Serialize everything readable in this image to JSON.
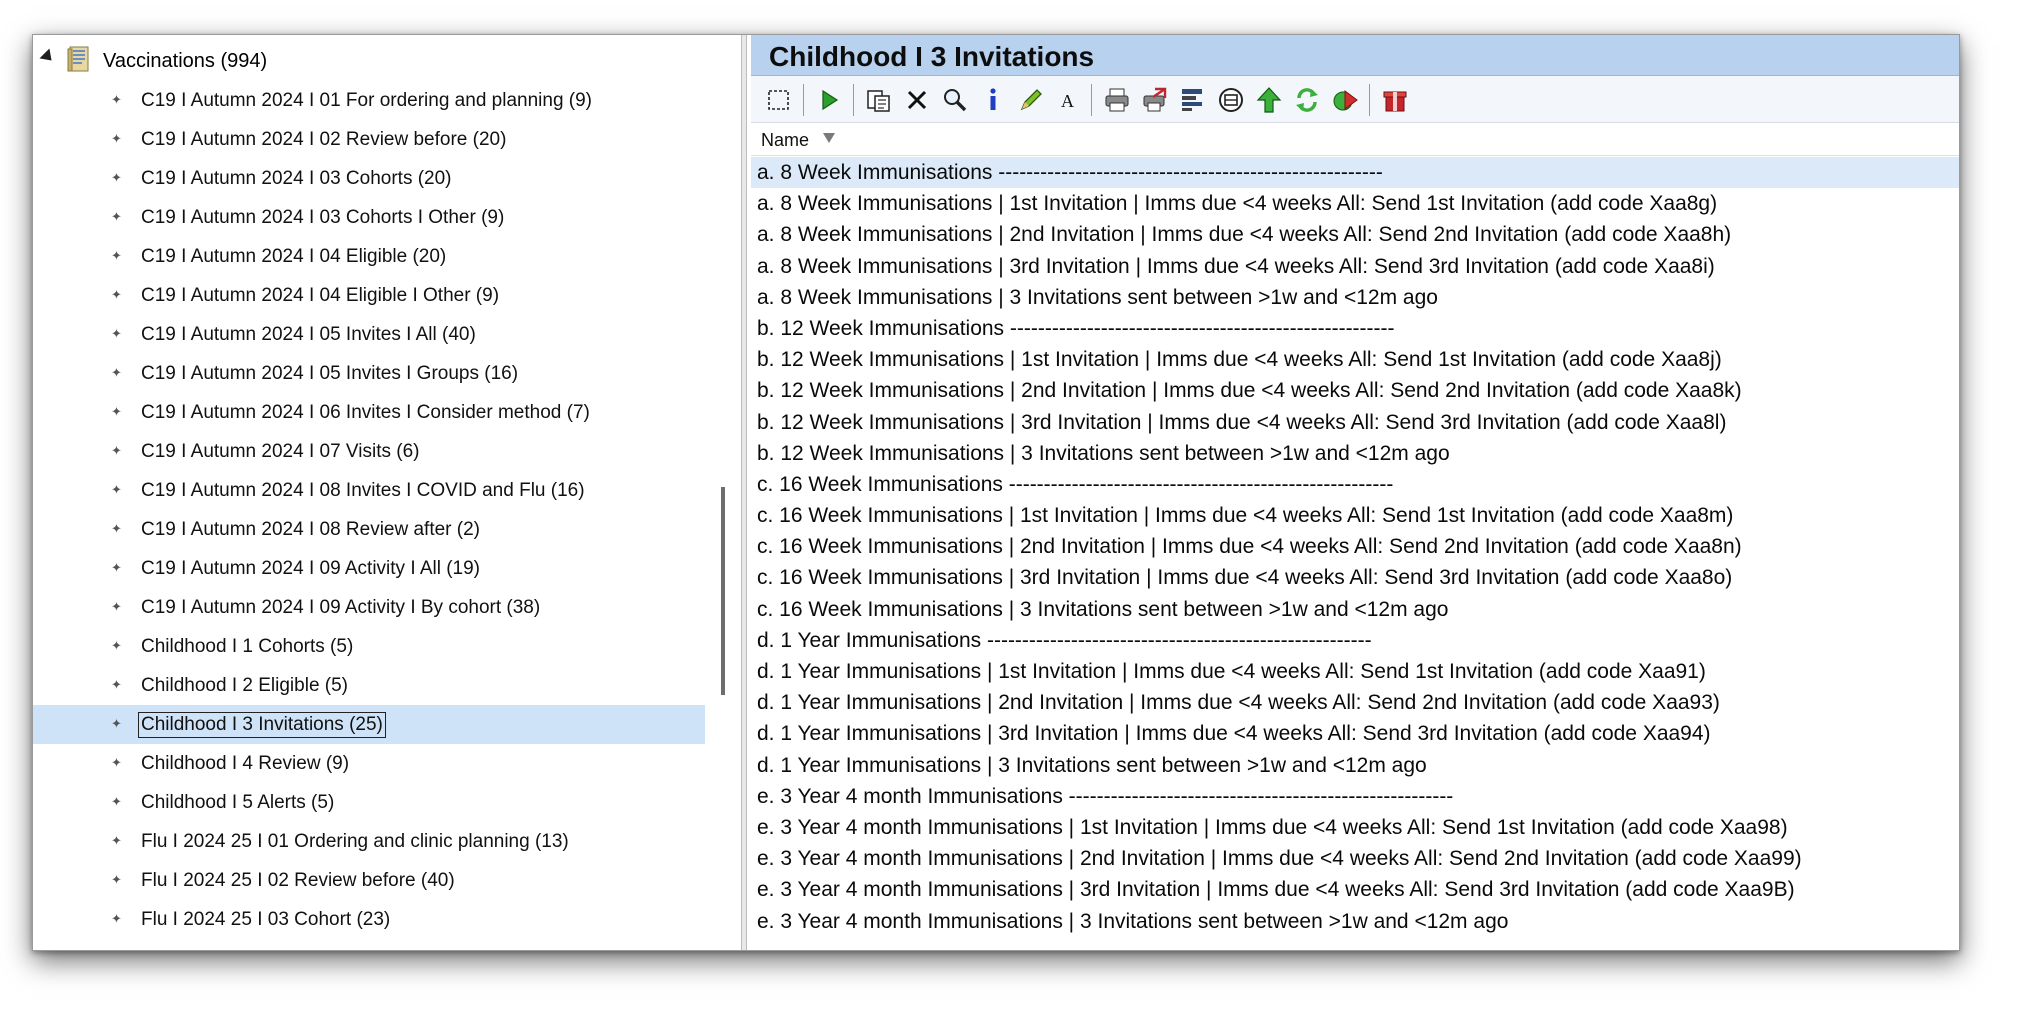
{
  "tree": {
    "root_label": "Vaccinations (994)",
    "items": [
      {
        "label": "C19 I Autumn 2024 I 01 For ordering and planning (9)"
      },
      {
        "label": "C19 I Autumn 2024 I 02 Review before (20)"
      },
      {
        "label": "C19 I Autumn 2024 I 03 Cohorts (20)"
      },
      {
        "label": "C19 I Autumn 2024 I 03 Cohorts I Other (9)"
      },
      {
        "label": "C19 I Autumn 2024 I 04 Eligible (20)"
      },
      {
        "label": "C19 I Autumn 2024 I 04 Eligible I Other (9)"
      },
      {
        "label": "C19 I Autumn 2024 I 05 Invites I All (40)"
      },
      {
        "label": "C19 I Autumn 2024 I 05 Invites I Groups (16)"
      },
      {
        "label": "C19 I Autumn 2024 I 06 Invites I Consider method (7)"
      },
      {
        "label": "C19 I Autumn 2024 I 07 Visits (6)"
      },
      {
        "label": "C19 I Autumn 2024 I 08 Invites I COVID and Flu (16)"
      },
      {
        "label": "C19 I Autumn 2024 I 08 Review after (2)"
      },
      {
        "label": "C19 I Autumn 2024 I 09 Activity I All (19)"
      },
      {
        "label": "C19 I Autumn 2024 I 09 Activity I By cohort (38)"
      },
      {
        "label": "Childhood I 1 Cohorts (5)"
      },
      {
        "label": "Childhood I 2 Eligible (5)"
      },
      {
        "label": "Childhood I 3 Invitations (25)",
        "selected": true
      },
      {
        "label": "Childhood I 4 Review (9)"
      },
      {
        "label": "Childhood I 5 Alerts (5)"
      },
      {
        "label": "Flu I 2024 25 I 01 Ordering and clinic planning (13)"
      },
      {
        "label": "Flu I 2024 25 I 02 Review before (40)"
      },
      {
        "label": "Flu I 2024 25 I 03 Cohort (23)"
      }
    ]
  },
  "panel": {
    "title": "Childhood I 3 Invitations",
    "column_header": "Name",
    "rows": [
      "a. 8 Week Immunisations -------------------------------------------------------",
      "a. 8 Week Immunisations |  1st Invitation | Imms due <4 weeks All: Send 1st Invitation (add code Xaa8g)",
      "a. 8 Week Immunisations |  2nd Invitation | Imms due <4 weeks All: Send 2nd Invitation (add code Xaa8h)",
      "a. 8 Week Immunisations |  3rd Invitation | Imms due <4 weeks All: Send 3rd Invitation (add code Xaa8i)",
      "a. 8 Week Immunisations | 3 Invitations sent between >1w and <12m ago",
      "b. 12 Week Immunisations -------------------------------------------------------",
      "b. 12 Week Immunisations |  1st Invitation | Imms due <4 weeks All: Send 1st Invitation (add code Xaa8j)",
      "b. 12 Week Immunisations |  2nd Invitation | Imms due <4 weeks All: Send 2nd Invitation (add code Xaa8k)",
      "b. 12 Week Immunisations |  3rd Invitation | Imms due <4 weeks All: Send 3rd Invitation (add code Xaa8l)",
      "b. 12 Week Immunisations | 3 Invitations sent between >1w and <12m ago",
      "c. 16 Week Immunisations -------------------------------------------------------",
      "c. 16 Week Immunisations |  1st Invitation | Imms due <4 weeks All: Send 1st Invitation (add code Xaa8m)",
      "c. 16 Week Immunisations |  2nd Invitation | Imms due <4 weeks All: Send 2nd Invitation (add code Xaa8n)",
      "c. 16 Week Immunisations |  3rd Invitation | Imms due <4 weeks All: Send 3rd Invitation (add code Xaa8o)",
      "c. 16 Week Immunisations | 3 Invitations sent between >1w and <12m ago",
      "d. 1 Year Immunisations -------------------------------------------------------",
      "d. 1 Year Immunisations |  1st Invitation | Imms due <4 weeks All: Send 1st Invitation (add code Xaa91)",
      "d. 1 Year Immunisations |  2nd Invitation | Imms due <4 weeks All: Send 2nd Invitation (add code Xaa93)",
      "d. 1 Year Immunisations |  3rd Invitation | Imms due <4 weeks All: Send 3rd Invitation (add code Xaa94)",
      "d. 1 Year Immunisations | 3 Invitations sent between >1w and <12m ago",
      "e. 3 Year 4 month Immunisations -------------------------------------------------------",
      "e. 3 Year 4 month Immunisations |  1st Invitation | Imms due <4 weeks All: Send 1st Invitation (add code Xaa98)",
      "e. 3 Year 4 month Immunisations |  2nd Invitation | Imms due <4 weeks All: Send 2nd Invitation (add code Xaa99)",
      "e. 3 Year 4 month Immunisations |  3rd Invitation | Imms due <4 weeks All: Send 3rd Invitation (add code Xaa9B)",
      "e. 3 Year 4 month Immunisations | 3 Invitations sent between >1w and <12m ago"
    ]
  },
  "toolbar": {
    "buttons": [
      "select-icon",
      "run-icon",
      "copy-icon",
      "delete-icon",
      "search-icon",
      "info-icon",
      "edit-icon",
      "font-icon",
      "print-icon",
      "print-export-icon",
      "report-icon",
      "group-icon",
      "move-up-icon",
      "refresh-icon",
      "forward-icon",
      "gift-icon"
    ]
  },
  "colors": {
    "title_bar": "#b7d1ef",
    "selected_row": "#dbe9f8",
    "selected_tree_item": "#cfe3f8"
  }
}
